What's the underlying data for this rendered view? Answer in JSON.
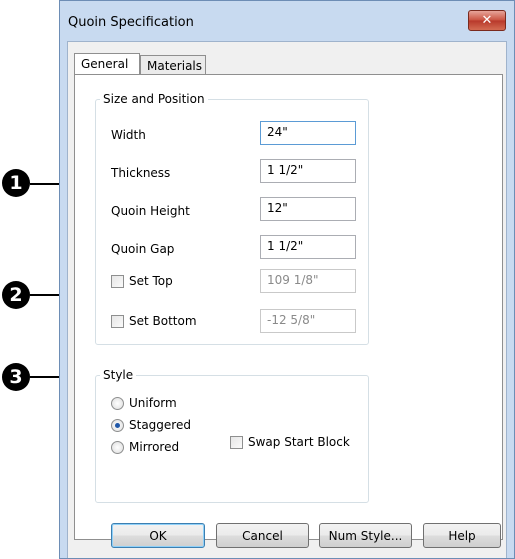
{
  "window": {
    "title": "Quoin Specification",
    "close_glyph": "✕"
  },
  "tabs": [
    {
      "label": "General",
      "active": true
    },
    {
      "label": "Materials",
      "active": false
    }
  ],
  "size_position": {
    "legend": "Size and Position",
    "width_label": "Width",
    "width_value": "24\"",
    "thickness_label": "Thickness",
    "thickness_value": "1 1/2\"",
    "quoin_height_label": "Quoin Height",
    "quoin_height_value": "12\"",
    "quoin_gap_label": "Quoin Gap",
    "quoin_gap_value": "1 1/2\"",
    "set_top_label": "Set Top",
    "set_top_checked": false,
    "set_top_value": "109 1/8\"",
    "set_bottom_label": "Set Bottom",
    "set_bottom_checked": false,
    "set_bottom_value": "-12 5/8\""
  },
  "style": {
    "legend": "Style",
    "options": [
      "Uniform",
      "Staggered",
      "Mirrored"
    ],
    "selected": "Staggered",
    "swap_start_block_label": "Swap Start Block",
    "swap_start_block_checked": false
  },
  "buttons": {
    "ok": "OK",
    "cancel": "Cancel",
    "num_style": "Num Style...",
    "help": "Help"
  },
  "callouts": [
    "1",
    "2",
    "3"
  ]
}
